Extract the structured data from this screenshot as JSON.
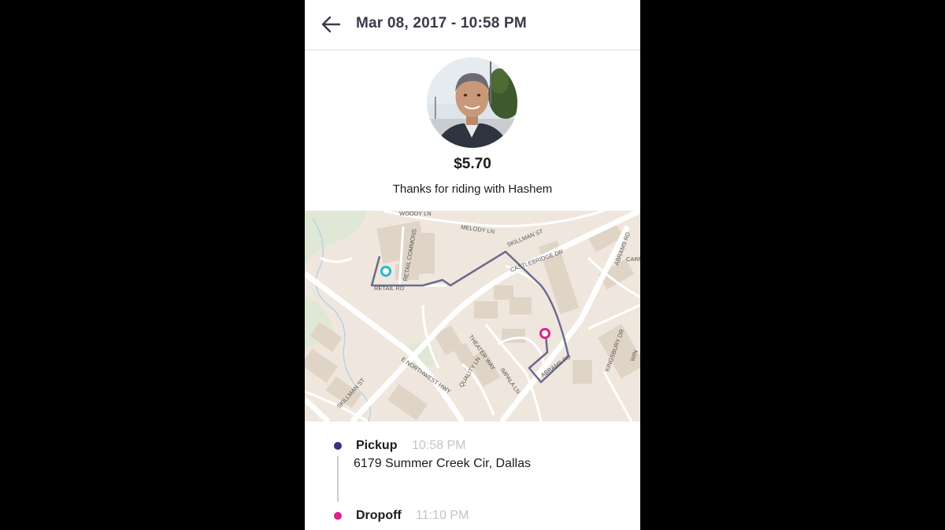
{
  "header": {
    "title": "Mar 08, 2017 - 10:58 PM",
    "back_icon": "arrow-left-icon"
  },
  "ride": {
    "fare": "$5.70",
    "thanks": "Thanks for riding with Hashem"
  },
  "map": {
    "streets": {
      "woody": "WOODY LN",
      "melody": "MELODY LN",
      "skillman_rd": "SKILLMAN ST",
      "retail_commons": "RETAIL COMMONS",
      "retail_rd": "RETAIL RD",
      "castlebridge": "CASTLEBRIDGE DR",
      "abrams_rd": "ABRAMS RD",
      "carma": "CARM",
      "abrams_rd2": "ABRAMS RD",
      "theater": "THEATER WAY",
      "impala": "IMPALA LN",
      "quality": "QUALITY LN",
      "northwest": "E NORTHWEST HWY",
      "skillman_st": "SKILLMAN ST",
      "kingsbury": "KINGSBURY DR",
      "win": "WIN"
    },
    "colors": {
      "route": "#6b6a8a",
      "pickup_pin": "#29b6d8",
      "dropoff_pin": "#e0218a"
    }
  },
  "trip": {
    "pickup": {
      "label": "Pickup",
      "time": "10:58 PM",
      "address": "6179 Summer Creek Cir, Dallas",
      "color": "#3b2f7a"
    },
    "dropoff": {
      "label": "Dropoff",
      "time": "11:10 PM",
      "color": "#e0218a"
    }
  }
}
